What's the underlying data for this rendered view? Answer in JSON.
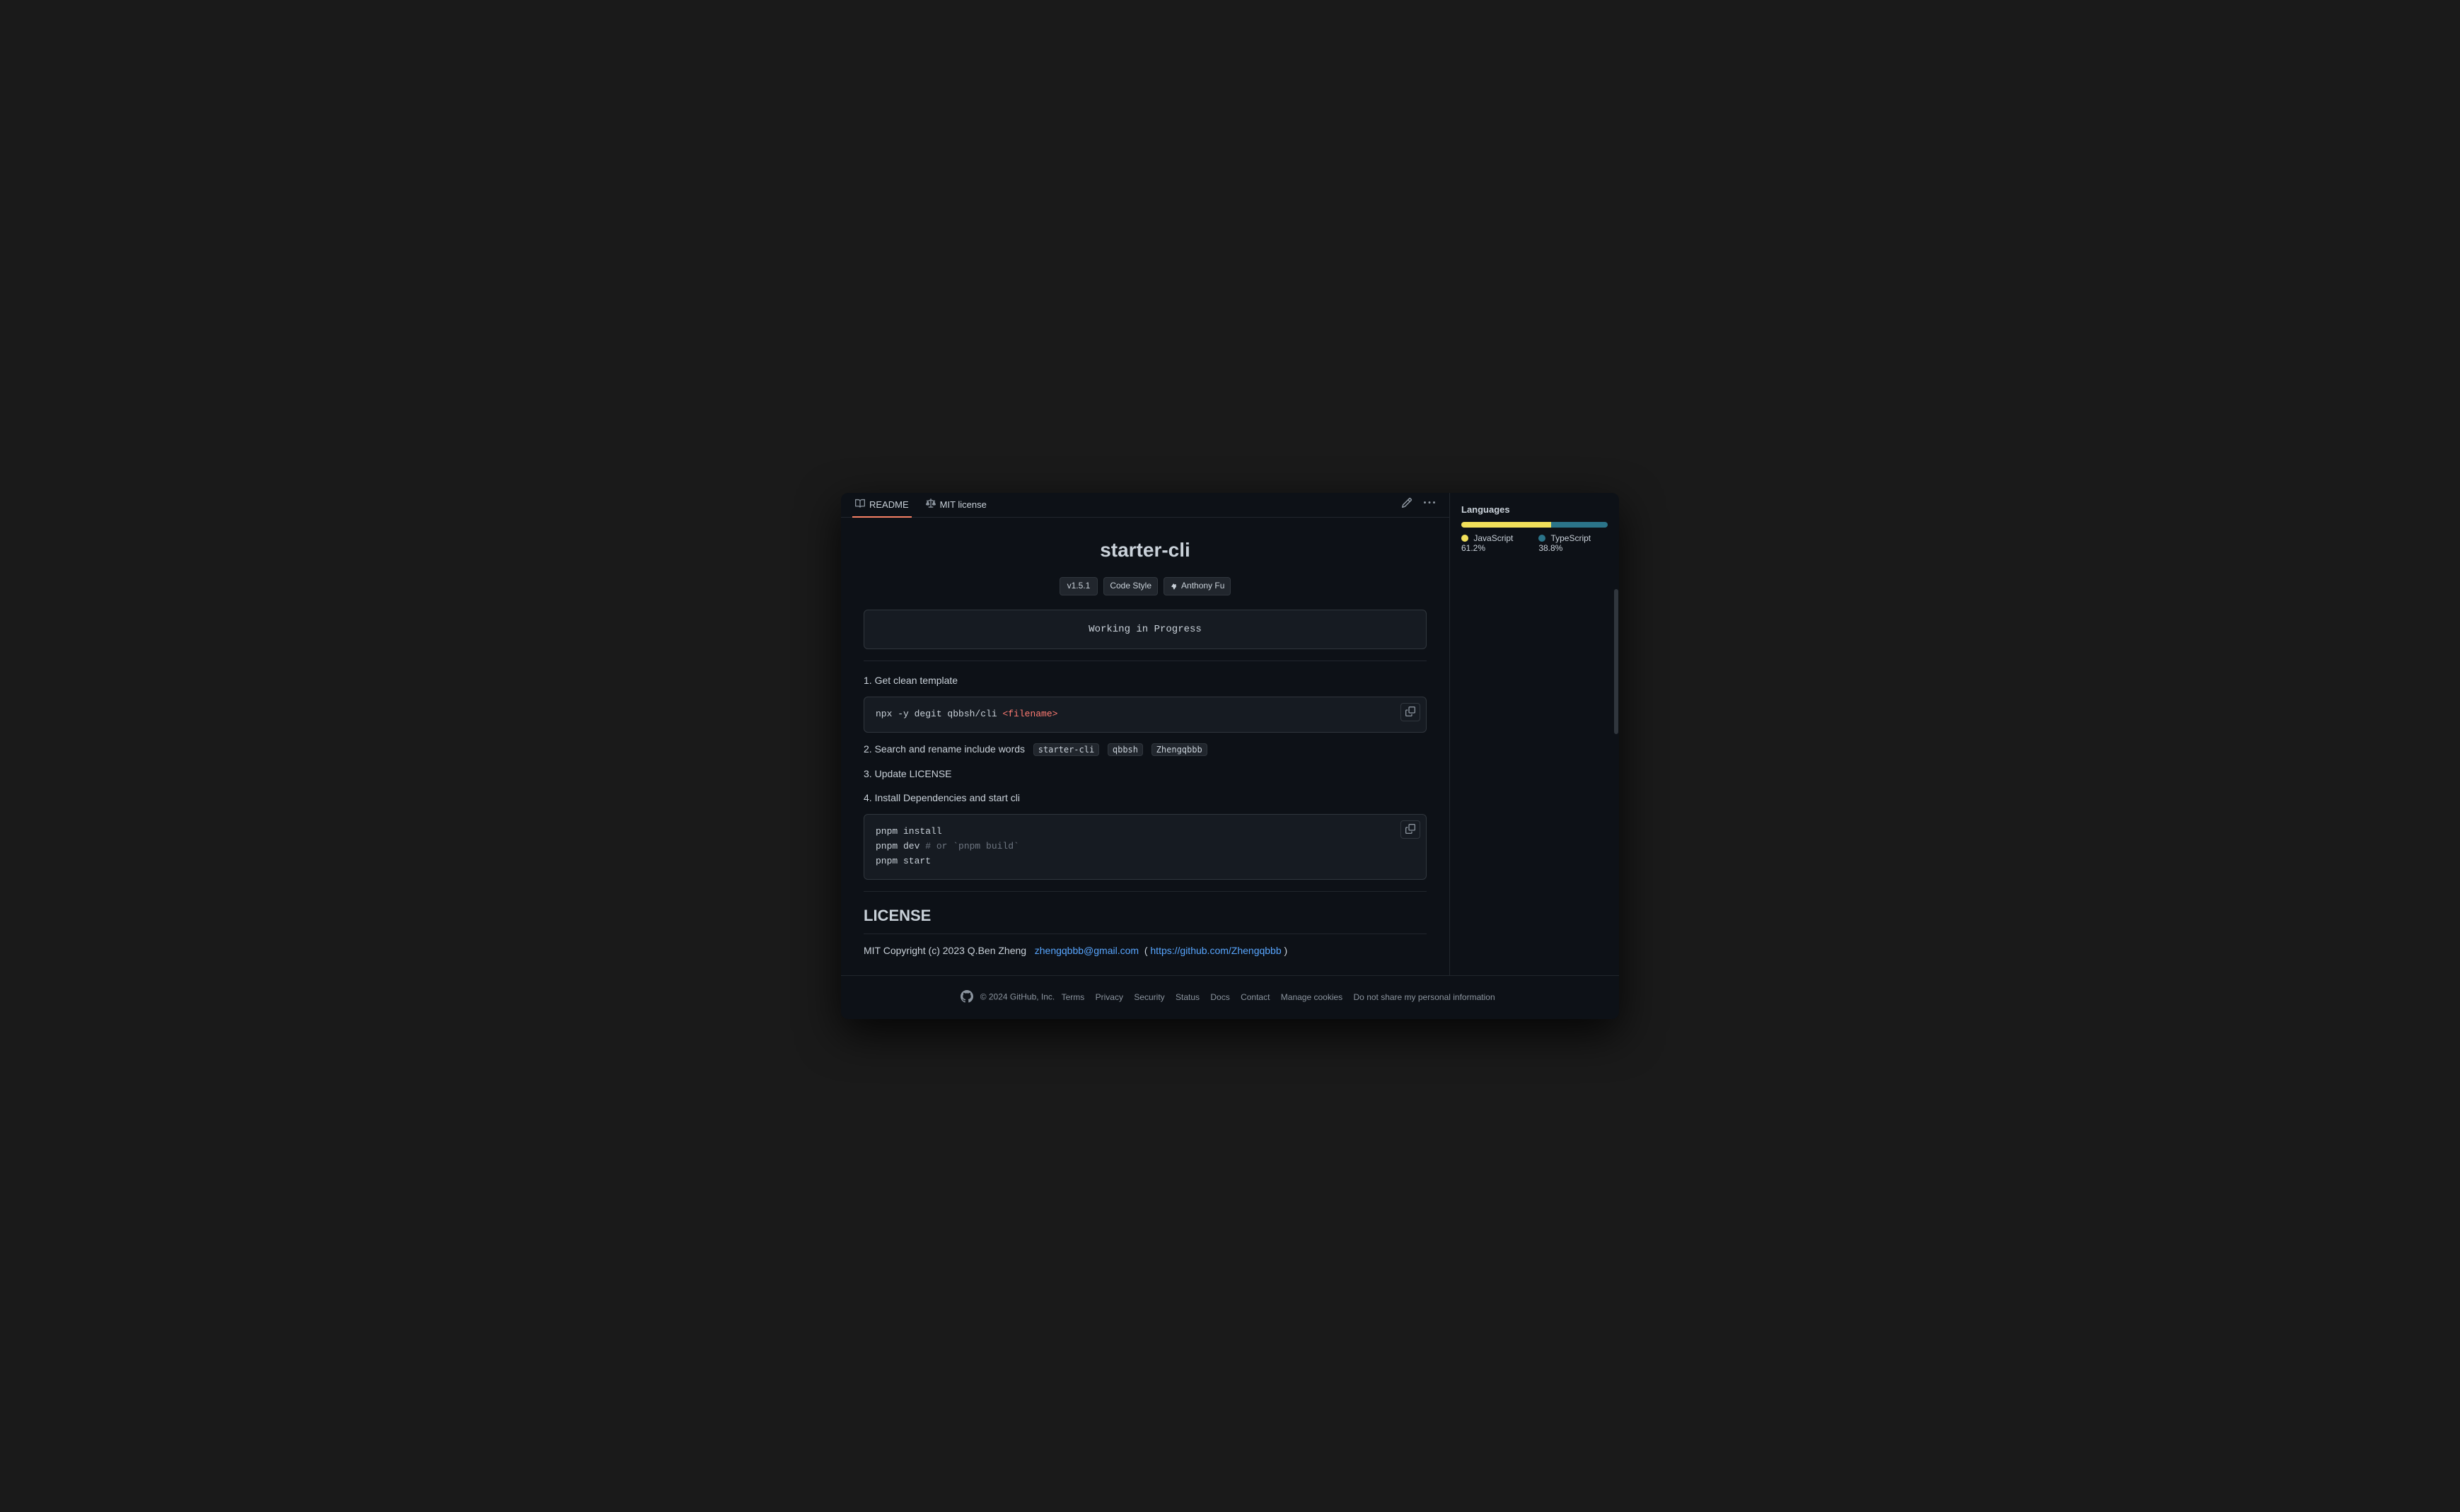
{
  "window": {
    "background": "#0d1117"
  },
  "tabs": {
    "readme": {
      "label": "README",
      "icon": "book-icon",
      "active": true
    },
    "license": {
      "label": "MIT license",
      "icon": "law-icon"
    }
  },
  "readme": {
    "title": "starter-cli",
    "version_badge": "v1.5.1",
    "code_style_badge": "Code Style",
    "author_badge": "Anthony Fu",
    "wip_text": "Working in Progress",
    "steps": [
      {
        "number": "1.",
        "text": "Get clean template"
      },
      {
        "number": "2.",
        "text": "Search and rename include words"
      },
      {
        "number": "3.",
        "text": "Update LICENSE"
      },
      {
        "number": "4.",
        "text": "Install Dependencies and start cli"
      }
    ],
    "code_block_1": {
      "line": "npx -y degit qbbsh/cli <filename>"
    },
    "code_block_2": {
      "line1": "pnpm install",
      "line2": "pnpm dev # or `pnpm build`",
      "line3": "pnpm start"
    },
    "rename_tags": [
      "starter-cli",
      "qbbsh",
      "Zhengqbbb"
    ],
    "license_section_title": "LICENSE",
    "license_text": "MIT Copyright (c) 2023 Q.Ben Zheng",
    "license_email": "zhengqbbb@gmail.com",
    "license_url": "https://github.com/Zhengqbbb",
    "license_close": ")"
  },
  "sidebar": {
    "languages_title": "Languages",
    "javascript": {
      "label": "JavaScript",
      "percent": "61.2%",
      "color": "#f1e05a"
    },
    "typescript": {
      "label": "TypeScript",
      "percent": "38.8%",
      "color": "#2b7489"
    }
  },
  "footer": {
    "copyright": "© 2024 GitHub, Inc.",
    "links": [
      "Terms",
      "Privacy",
      "Security",
      "Status",
      "Docs",
      "Contact",
      "Manage cookies",
      "Do not share my personal information"
    ]
  }
}
